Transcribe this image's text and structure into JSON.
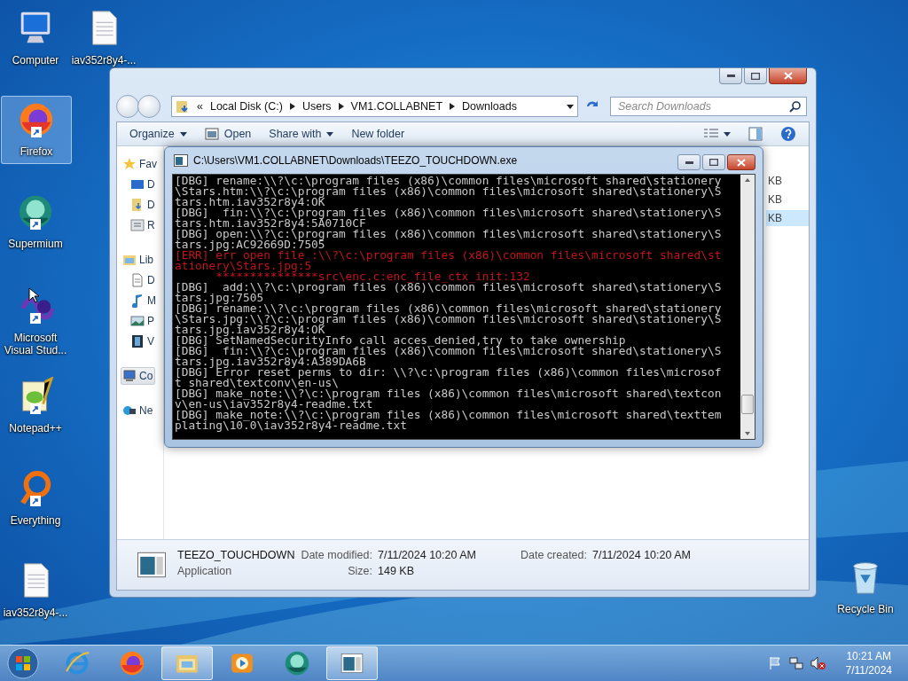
{
  "desktop": {
    "icons": [
      {
        "label": "Computer",
        "kind": "computer",
        "selected": false
      },
      {
        "label": "iav352r8y4-...",
        "kind": "document",
        "selected": false
      },
      {
        "label": "Firefox",
        "kind": "firefox",
        "selected": true
      },
      {
        "label": "Supermium",
        "kind": "supermium",
        "selected": false
      },
      {
        "label": "Microsoft Visual Stud...",
        "kind": "vs",
        "selected": false
      },
      {
        "label": "Notepad++",
        "kind": "notepad",
        "selected": false
      },
      {
        "label": "Everything",
        "kind": "everything",
        "selected": false
      },
      {
        "label": "iav352r8y4-...",
        "kind": "document",
        "selected": false
      },
      {
        "label": "Recycle Bin",
        "kind": "recycle",
        "selected": false
      }
    ]
  },
  "explorer": {
    "address": {
      "overflow": "«",
      "crumbs": [
        "Local Disk (C:)",
        "Users",
        "VM1.COLLABNET",
        "Downloads"
      ]
    },
    "search": {
      "placeholder": "Search Downloads"
    },
    "toolbar": [
      {
        "label": "Organize",
        "dropdown": true,
        "kind": "text"
      },
      {
        "label": "Open",
        "dropdown": false,
        "kind": "open"
      },
      {
        "label": "Share with",
        "dropdown": true,
        "kind": "text"
      },
      {
        "label": "New folder",
        "dropdown": false,
        "kind": "text"
      }
    ],
    "sidebar": [
      {
        "label": "Fav",
        "kind": "star",
        "selected": false,
        "children": [
          {
            "label": "D",
            "kind": "desktop",
            "selected": false
          },
          {
            "label": "D",
            "kind": "downloads",
            "selected": false
          },
          {
            "label": "R",
            "kind": "recent",
            "selected": false
          }
        ]
      },
      {
        "label": "Lib",
        "kind": "library",
        "selected": false,
        "children": [
          {
            "label": "D",
            "kind": "docs",
            "selected": false
          },
          {
            "label": "M",
            "kind": "music",
            "selected": false
          },
          {
            "label": "P",
            "kind": "pictures",
            "selected": false
          },
          {
            "label": "V",
            "kind": "videos",
            "selected": false
          }
        ]
      },
      {
        "label": "Co",
        "kind": "computer",
        "selected": true
      },
      {
        "label": "Ne",
        "kind": "network",
        "selected": false
      }
    ],
    "rows": [
      {
        "size": "KB",
        "selected": false
      },
      {
        "size": "KB",
        "selected": false
      },
      {
        "size": "KB",
        "selected": true
      }
    ],
    "details": {
      "name": "TEEZO_TOUCHDOWN",
      "type": "Application",
      "modified_label": "Date modified:",
      "modified": "7/11/2024 10:20 AM",
      "size_label": "Size:",
      "size": "149 KB",
      "created_label": "Date created:",
      "created": "7/11/2024 10:20 AM"
    }
  },
  "console": {
    "title": "C:\\Users\\VM1.COLLABNET\\Downloads\\TEEZO_TOUCHDOWN.exe",
    "lines": [
      {
        "kind": "dbg",
        "text": "[DBG] rename:\\\\?\\c:\\program files (x86)\\common files\\microsoft shared\\stationery"
      },
      {
        "kind": "dbg",
        "text": "\\Stars.htm:\\\\?\\c:\\program files (x86)\\common files\\microsoft shared\\stationery\\S"
      },
      {
        "kind": "dbg",
        "text": "tars.htm.iav352r8y4:OK"
      },
      {
        "kind": "dbg",
        "text": "[DBG]  fin:\\\\?\\c:\\program files (x86)\\common files\\microsoft shared\\stationery\\S"
      },
      {
        "kind": "dbg",
        "text": "tars.htm.iav352r8y4:5A0710CF"
      },
      {
        "kind": "dbg",
        "text": "[DBG] open:\\\\?\\c:\\program files (x86)\\common files\\microsoft shared\\stationery\\S"
      },
      {
        "kind": "dbg",
        "text": "tars.jpg:AC92669D:7505"
      },
      {
        "kind": "err",
        "text": "[ERR] err open file :\\\\?\\c:\\program files (x86)\\common files\\microsoft shared\\st"
      },
      {
        "kind": "err",
        "text": "ationery\\Stars.jpg:5"
      },
      {
        "kind": "err",
        "text": "      ***************src\\enc.c:enc_file_ctx_init:132"
      },
      {
        "kind": "dbg",
        "text": "[DBG]  add:\\\\?\\c:\\program files (x86)\\common files\\microsoft shared\\stationery\\S"
      },
      {
        "kind": "dbg",
        "text": "tars.jpg:7505"
      },
      {
        "kind": "dbg",
        "text": "[DBG] rename:\\\\?\\c:\\program files (x86)\\common files\\microsoft shared\\stationery"
      },
      {
        "kind": "dbg",
        "text": "\\Stars.jpg:\\\\?\\c:\\program files (x86)\\common files\\microsoft shared\\stationery\\S"
      },
      {
        "kind": "dbg",
        "text": "tars.jpg.iav352r8y4:OK"
      },
      {
        "kind": "dbg",
        "text": "[DBG] SetNamedSecurityInfo call acces_denied,try to take ownership"
      },
      {
        "kind": "dbg",
        "text": "[DBG]  fin:\\\\?\\c:\\program files (x86)\\common files\\microsoft shared\\stationery\\S"
      },
      {
        "kind": "dbg",
        "text": "tars.jpg.iav352r8y4:A389DA6B"
      },
      {
        "kind": "dbg",
        "text": "[DBG] Error reset perms to dir: \\\\?\\c:\\program files (x86)\\common files\\microsof"
      },
      {
        "kind": "dbg",
        "text": "t shared\\textconv\\en-us\\"
      },
      {
        "kind": "dbg",
        "text": "[DBG] make_note:\\\\?\\c:\\program files (x86)\\common files\\microsoft shared\\textcon"
      },
      {
        "kind": "dbg",
        "text": "v\\en-us\\iav352r8y4-readme.txt"
      },
      {
        "kind": "dbg",
        "text": "[DBG] make_note:\\\\?\\c:\\program files (x86)\\common files\\microsoft shared\\texttem"
      },
      {
        "kind": "dbg",
        "text": "plating\\10.0\\iav352r8y4-readme.txt"
      }
    ]
  },
  "taskbar": {
    "apps": [
      {
        "kind": "ie",
        "active": false
      },
      {
        "kind": "firefox",
        "active": false
      },
      {
        "kind": "explorer",
        "active": true
      },
      {
        "kind": "media",
        "active": false
      },
      {
        "kind": "supermium",
        "active": false
      },
      {
        "kind": "console",
        "active": true
      }
    ],
    "time": "10:21 AM",
    "date": "7/11/2024"
  }
}
